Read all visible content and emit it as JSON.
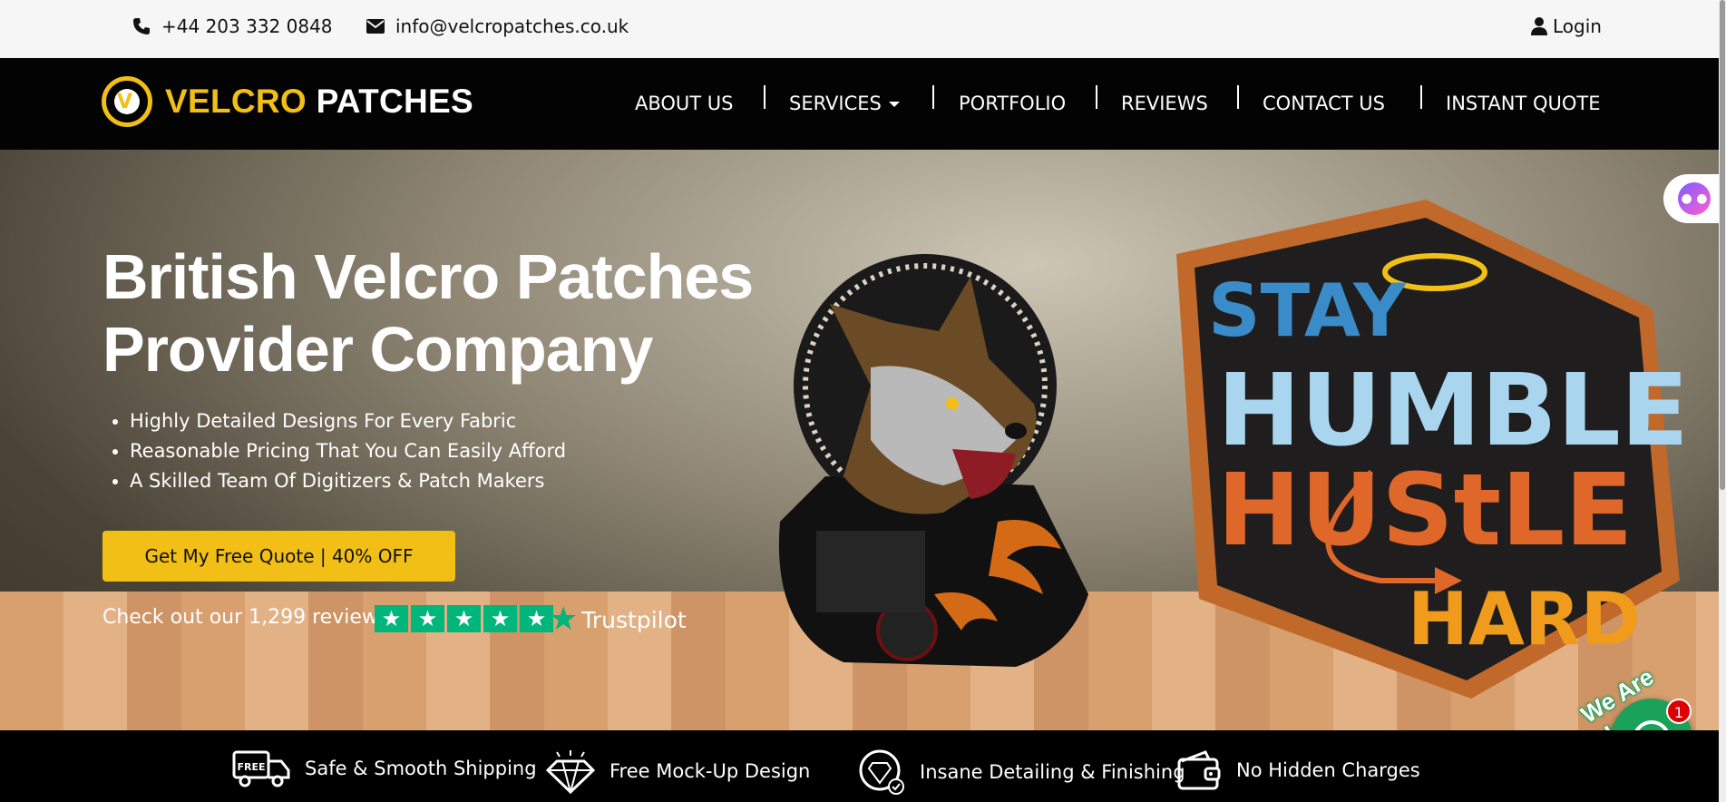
{
  "topbar": {
    "phone": "+44 203 332 0848",
    "email": "info@velcropatches.co.uk",
    "login": "Login"
  },
  "header": {
    "logo_word1": "VELCRO",
    "logo_word2": "PATCHES",
    "nav": [
      "ABOUT US",
      "SERVICES",
      "PORTFOLIO",
      "REVIEWS",
      "CONTACT US",
      "INSTANT QUOTE"
    ]
  },
  "hero": {
    "title_line1": "British Velcro Patches",
    "title_line2": "Provider Company",
    "bullets": [
      "Highly Detailed Designs For Every Fabric",
      "Reasonable Pricing That You Can Easily Afford",
      "A Skilled Team Of Digitizers & Patch Makers"
    ],
    "cta": "Get My Free Quote | 40% OFF",
    "reviews_text": "Check out our 1,299 reviews",
    "trustpilot": "Trustpilot",
    "rating_stars": 5
  },
  "patch": {
    "line1": "STAY",
    "line2": "HUMBLE",
    "line3": "HUStLE",
    "line4": "HARD"
  },
  "chat": {
    "badge": "1",
    "label": "We Are Here!"
  },
  "features": [
    {
      "label": "Safe & Smooth Shipping",
      "icon": "truck-icon",
      "icon_text": "FREE"
    },
    {
      "label": "Free Mock-Up Design",
      "icon": "diamond-icon"
    },
    {
      "label": "Insane Detailing & Finishing",
      "icon": "gem-badge-icon"
    },
    {
      "label": "No Hidden Charges",
      "icon": "wallet-icon"
    }
  ],
  "colors": {
    "brand_yellow": "#f1bf16",
    "trustpilot_green": "#00b67a",
    "chat_green": "#1aa15a"
  }
}
